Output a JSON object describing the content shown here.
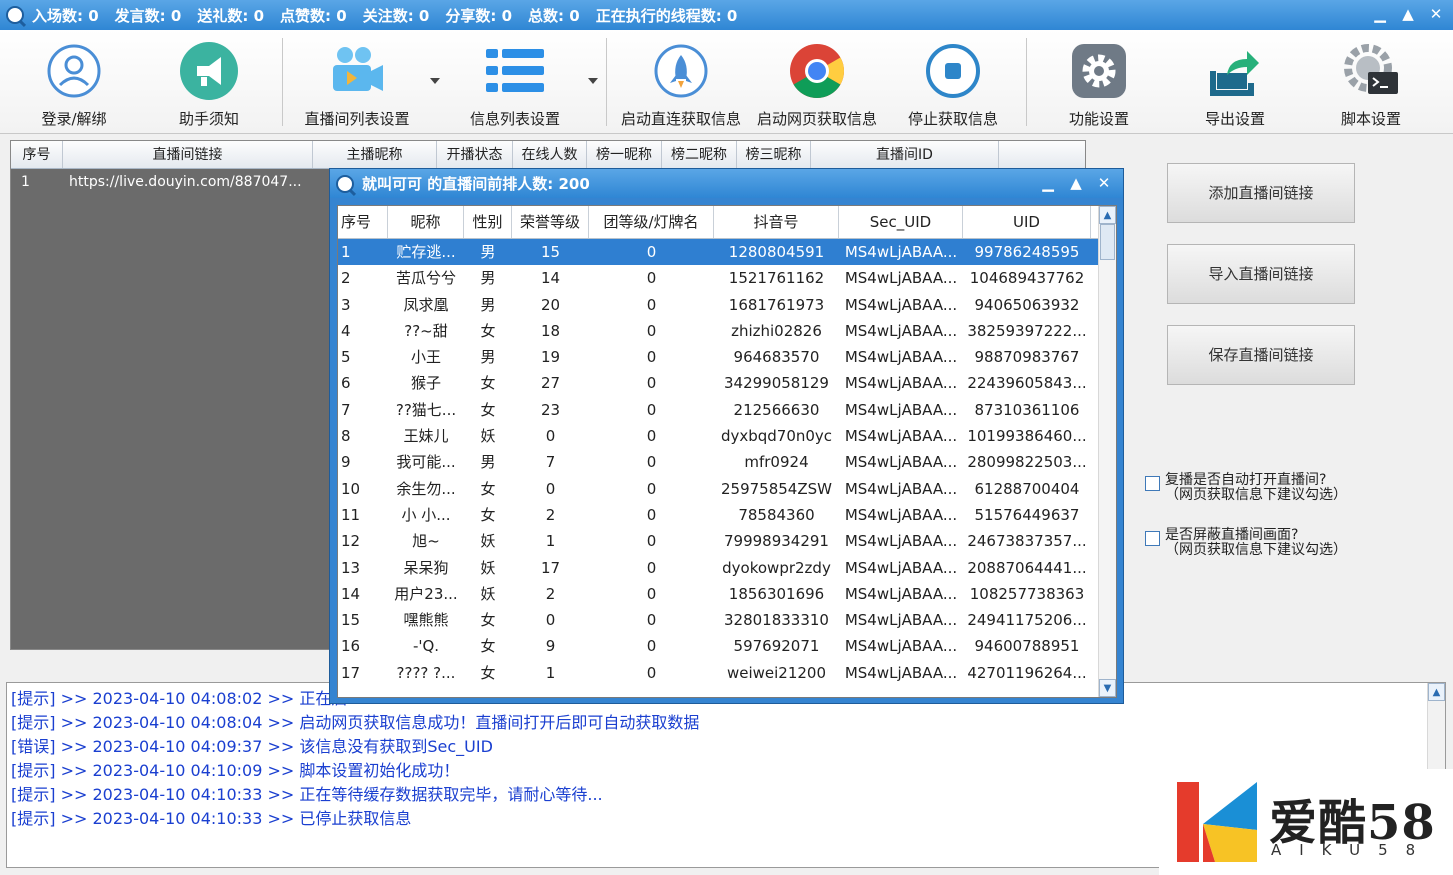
{
  "title_bar": {
    "stats": [
      "入场数: 0",
      "发言数: 0",
      "送礼数: 0",
      "点赞数: 0",
      "关注数: 0",
      "分享数: 0",
      "总数: 0",
      "正在执行的线程数: 0"
    ],
    "controls": [
      "▁",
      "▲",
      "✕"
    ]
  },
  "toolbar": {
    "login": "登录/解绑",
    "notice": "助手须知",
    "room_list_settings": "直播间列表设置",
    "info_list_settings": "信息列表设置",
    "start_live_fetch": "启动直连获取信息",
    "start_web_fetch": "启动网页获取信息",
    "stop_fetch": "停止获取信息",
    "feature_settings": "功能设置",
    "export_settings": "导出设置",
    "script_settings": "脚本设置"
  },
  "main_list": {
    "headers": [
      "序号",
      "直播间链接",
      "主播昵称",
      "开播状态",
      "在线人数",
      "榜一昵称",
      "榜二昵称",
      "榜三昵称",
      "直播间ID"
    ],
    "rows": [
      {
        "no": "1",
        "url": "https://live.douyin.com/887047..."
      }
    ]
  },
  "side_buttons": {
    "add_link": "添加直播间链接",
    "import_link": "导入直播间链接",
    "save_link": "保存直播间链接"
  },
  "checkboxes": [
    {
      "line1": "复播是否自动打开直播间?",
      "line2": "（网页获取信息下建议勾选）",
      "checked": false
    },
    {
      "line1": "是否屏蔽直播间画面?",
      "line2": "（网页获取信息下建议勾选）",
      "checked": false
    }
  ],
  "log_lines": [
    "[提示] >> 2023-04-10 04:08:02 >> 正在启",
    "[提示] >> 2023-04-10 04:08:04 >> 启动网页获取信息成功！直播间打开后即可自动获取数据",
    "[错误] >> 2023-04-10 04:09:37 >> 该信息没有获取到Sec_UID",
    "[提示] >> 2023-04-10 04:10:09 >> 脚本设置初始化成功！",
    "[提示] >> 2023-04-10 04:10:33 >> 正在等待缓存数据获取完毕，请耐心等待...",
    "[提示] >> 2023-04-10 04:10:33 >> 已停止获取信息"
  ],
  "dialog": {
    "title": "就叫可可 的直播间前排人数: 200",
    "controls": [
      "▁",
      "▲",
      "✕"
    ],
    "headers": [
      "序号",
      "昵称",
      "性别",
      "荣誉等级",
      "团等级/灯牌名",
      "抖音号",
      "Sec_UID",
      "UID"
    ],
    "rows": [
      [
        "1",
        "贮存逃...",
        "男",
        "15",
        "0",
        "1280804591",
        "MS4wLjABAA...",
        "99786248595"
      ],
      [
        "2",
        "苦瓜兮兮",
        "男",
        "14",
        "0",
        "1521761162",
        "MS4wLjABAA...",
        "104689437762"
      ],
      [
        "3",
        "凤求凰",
        "男",
        "20",
        "0",
        "1681761973",
        "MS4wLjABAA...",
        "94065063932"
      ],
      [
        "4",
        "??~甜",
        "女",
        "18",
        "0",
        "zhizhi02826",
        "MS4wLjABAA...",
        "38259397222..."
      ],
      [
        "5",
        "小王",
        "男",
        "19",
        "0",
        "964683570",
        "MS4wLjABAA...",
        "98870983767"
      ],
      [
        "6",
        "猴子",
        "女",
        "27",
        "0",
        "34299058129",
        "MS4wLjABAA...",
        "22439605843..."
      ],
      [
        "7",
        "??猫七...",
        "女",
        "23",
        "0",
        "212566630",
        "MS4wLjABAA...",
        "87310361106"
      ],
      [
        "8",
        "王妹儿",
        "妖",
        "0",
        "0",
        "dyxbqd70n0yc",
        "MS4wLjABAA...",
        "10199386460..."
      ],
      [
        "9",
        "我可能...",
        "男",
        "7",
        "0",
        "mfr0924",
        "MS4wLjABAA...",
        "28099822503..."
      ],
      [
        "10",
        "余生勿...",
        "女",
        "0",
        "0",
        "25975854ZSW",
        "MS4wLjABAA...",
        "61288700404"
      ],
      [
        "11",
        "小 小...",
        "女",
        "2",
        "0",
        "78584360",
        "MS4wLjABAA...",
        "51576449637"
      ],
      [
        "12",
        "旭~",
        "妖",
        "1",
        "0",
        "79998934291",
        "MS4wLjABAA...",
        "24673837357..."
      ],
      [
        "13",
        "呆呆狗",
        "妖",
        "17",
        "0",
        "dyokowpr2zdy",
        "MS4wLjABAA...",
        "20887064441..."
      ],
      [
        "14",
        "用户23...",
        "妖",
        "2",
        "0",
        "1856301696",
        "MS4wLjABAA...",
        "108257738363"
      ],
      [
        "15",
        "嘿熊熊",
        "女",
        "0",
        "0",
        "32801833310",
        "MS4wLjABAA...",
        "24941175206..."
      ],
      [
        "16",
        "-'Q.",
        "女",
        "9",
        "0",
        "597692071",
        "MS4wLjABAA...",
        "94600788951"
      ],
      [
        "17",
        "???? ?...",
        "女",
        "1",
        "0",
        "weiwei21200",
        "MS4wLjABAA...",
        "42701196264..."
      ]
    ],
    "selected_row": 0
  },
  "watermark": {
    "cn": "爱酷58",
    "en": "AIKU58"
  },
  "colors": {
    "title_bar": "#2f86d4",
    "selection": "#2f7fd1",
    "log_text": "#1a3fd0"
  }
}
